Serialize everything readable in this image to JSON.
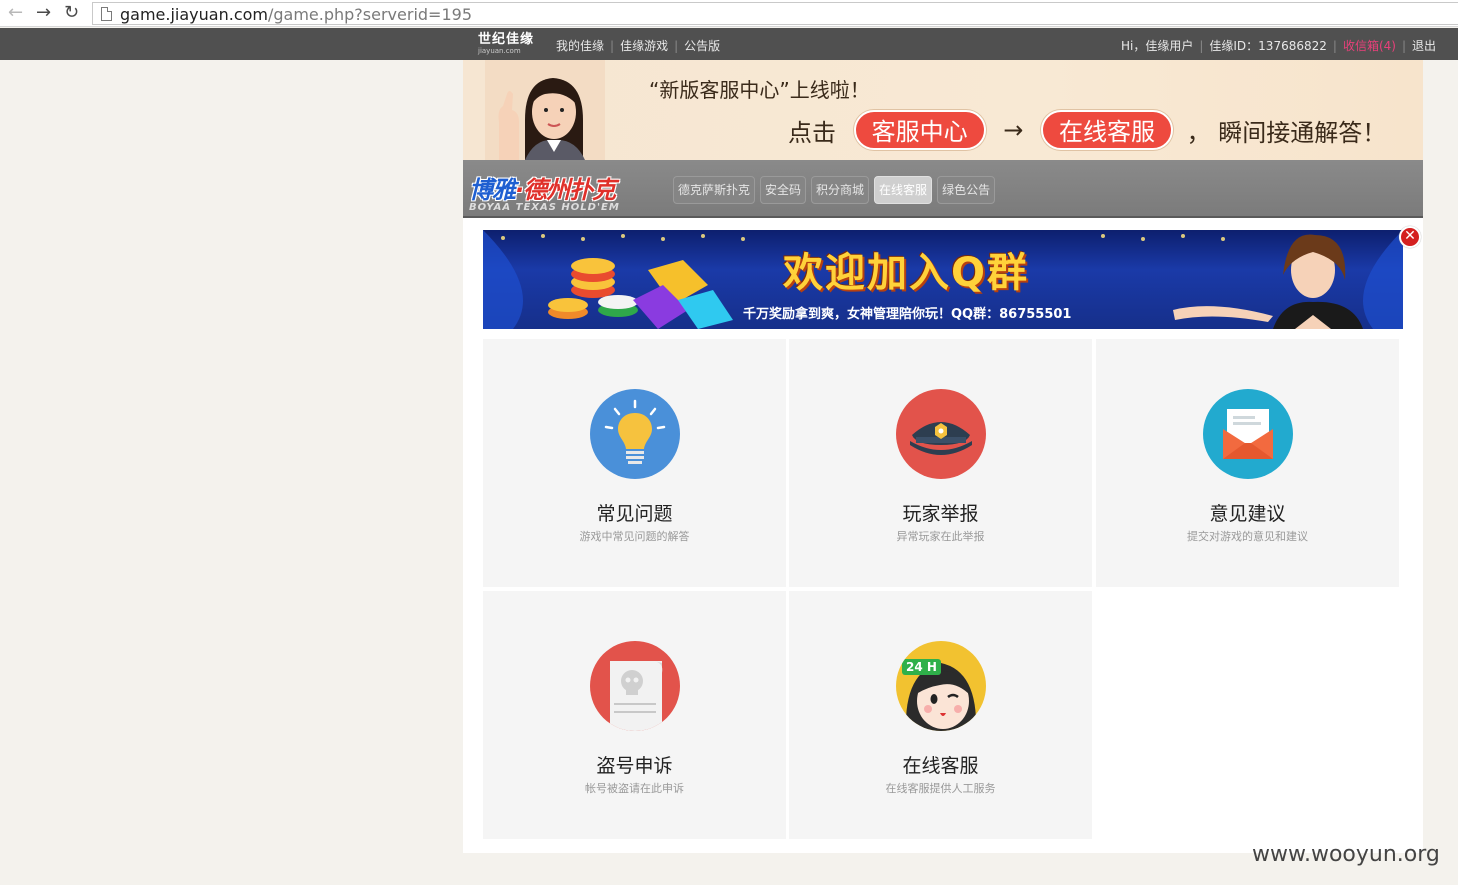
{
  "browser": {
    "url_host": "game.jiayuan.com",
    "url_path": "/game.php?serverid=195"
  },
  "topbar": {
    "logo_cn": "世纪佳缘",
    "logo_en": "jiayuan.com",
    "nav": [
      "我的佳缘",
      "佳缘游戏",
      "公告版"
    ],
    "greeting": "Hi，佳缘用户",
    "user_id": "佳缘ID：137686822",
    "mailbox": "收信箱(4)",
    "logout": "退出"
  },
  "promo": {
    "headline": "“新版客服中心”上线啦！",
    "click": "点击",
    "btn_center": "客服中心",
    "arrow": "→",
    "btn_online": "在线客服",
    "tail": "，  瞬间接通解答！"
  },
  "game": {
    "logo_part1": "博雅",
    "logo_dot": "·",
    "logo_part2": "德州扑克",
    "logo_en": "BOYAA TEXAS HOLD'EM",
    "tabs": [
      "德克萨斯扑克",
      "安全码",
      "积分商城",
      "在线客服",
      "绿色公告"
    ],
    "active_tab": "在线客服"
  },
  "qq_banner": {
    "title": "欢迎加入Q群",
    "subtitle": "千万奖励拿到爽，女神管理陪你玩！QQ群：86755501",
    "close_symbol": "✕"
  },
  "cards": [
    {
      "title": "常见问题",
      "desc": "游戏中常见问题的解答",
      "icon": "lightbulb-icon",
      "color": "#4a90d9"
    },
    {
      "title": "玩家举报",
      "desc": "异常玩家在此举报",
      "icon": "police-cap-icon",
      "color": "#e2534b"
    },
    {
      "title": "意见建议",
      "desc": "提交对游戏的意见和建议",
      "icon": "envelope-icon",
      "color": "#22aacf"
    },
    {
      "title": "盗号申诉",
      "desc": "帐号被盗请在此申诉",
      "icon": "skull-document-icon",
      "color": "#e2534b"
    },
    {
      "title": "在线客服",
      "desc": "在线客服提供人工服务",
      "icon": "service-girl-icon",
      "color": "#f2c230",
      "badge": "24 H"
    }
  ],
  "watermark": "www.wooyun.org"
}
